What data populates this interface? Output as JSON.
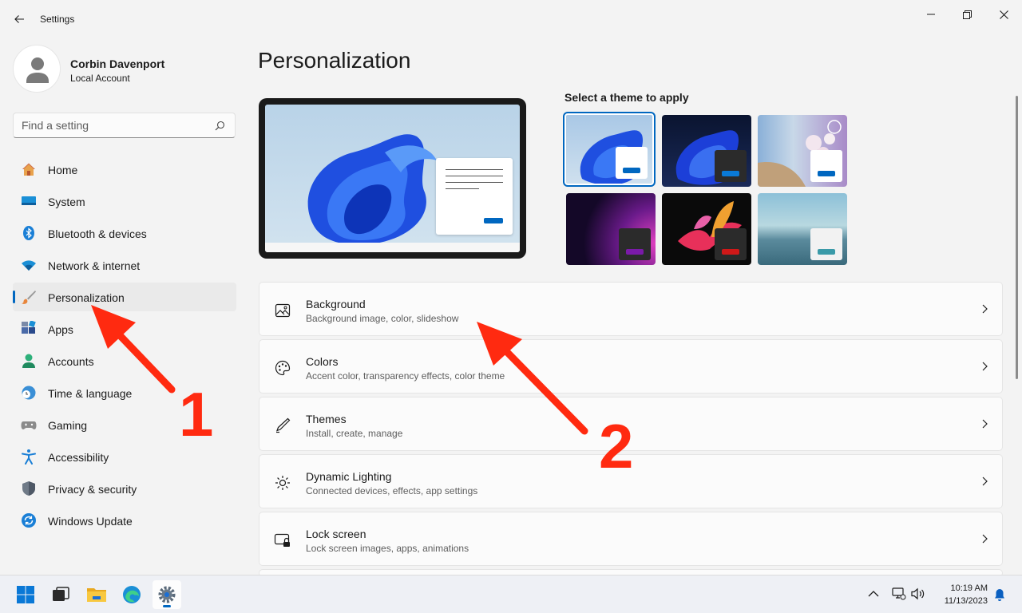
{
  "window": {
    "title": "Settings"
  },
  "profile": {
    "name": "Corbin Davenport",
    "account_type": "Local Account"
  },
  "search": {
    "placeholder": "Find a setting"
  },
  "nav": [
    {
      "label": "Home",
      "icon": "home-icon",
      "active": false
    },
    {
      "label": "System",
      "icon": "system-icon",
      "active": false
    },
    {
      "label": "Bluetooth & devices",
      "icon": "bluetooth-icon",
      "active": false
    },
    {
      "label": "Network & internet",
      "icon": "wifi-icon",
      "active": false
    },
    {
      "label": "Personalization",
      "icon": "brush-icon",
      "active": true
    },
    {
      "label": "Apps",
      "icon": "apps-icon",
      "active": false
    },
    {
      "label": "Accounts",
      "icon": "accounts-icon",
      "active": false
    },
    {
      "label": "Time & language",
      "icon": "clock-globe-icon",
      "active": false
    },
    {
      "label": "Gaming",
      "icon": "gamepad-icon",
      "active": false
    },
    {
      "label": "Accessibility",
      "icon": "accessibility-icon",
      "active": false
    },
    {
      "label": "Privacy & security",
      "icon": "shield-icon",
      "active": false
    },
    {
      "label": "Windows Update",
      "icon": "update-icon",
      "active": false
    }
  ],
  "main": {
    "title": "Personalization",
    "theme_label": "Select a theme to apply",
    "themes": [
      {
        "name": "windows-light",
        "selected": true
      },
      {
        "name": "windows-dark",
        "selected": false
      },
      {
        "name": "spotlight",
        "selected": false
      },
      {
        "name": "glow",
        "selected": false
      },
      {
        "name": "captured-motion",
        "selected": false
      },
      {
        "name": "flow",
        "selected": false
      }
    ],
    "rows": [
      {
        "title": "Background",
        "subtitle": "Background image, color, slideshow",
        "icon": "image-icon"
      },
      {
        "title": "Colors",
        "subtitle": "Accent color, transparency effects, color theme",
        "icon": "palette-icon"
      },
      {
        "title": "Themes",
        "subtitle": "Install, create, manage",
        "icon": "pen-icon"
      },
      {
        "title": "Dynamic Lighting",
        "subtitle": "Connected devices, effects, app settings",
        "icon": "lighting-icon"
      },
      {
        "title": "Lock screen",
        "subtitle": "Lock screen images, apps, animations",
        "icon": "lock-screen-icon"
      }
    ]
  },
  "annotations": {
    "first": "1",
    "second": "2",
    "color": "#ff2a10"
  },
  "taskbar": {
    "time": "10:19 AM",
    "date": "11/13/2023"
  },
  "colors": {
    "accent": "#0067c0"
  }
}
